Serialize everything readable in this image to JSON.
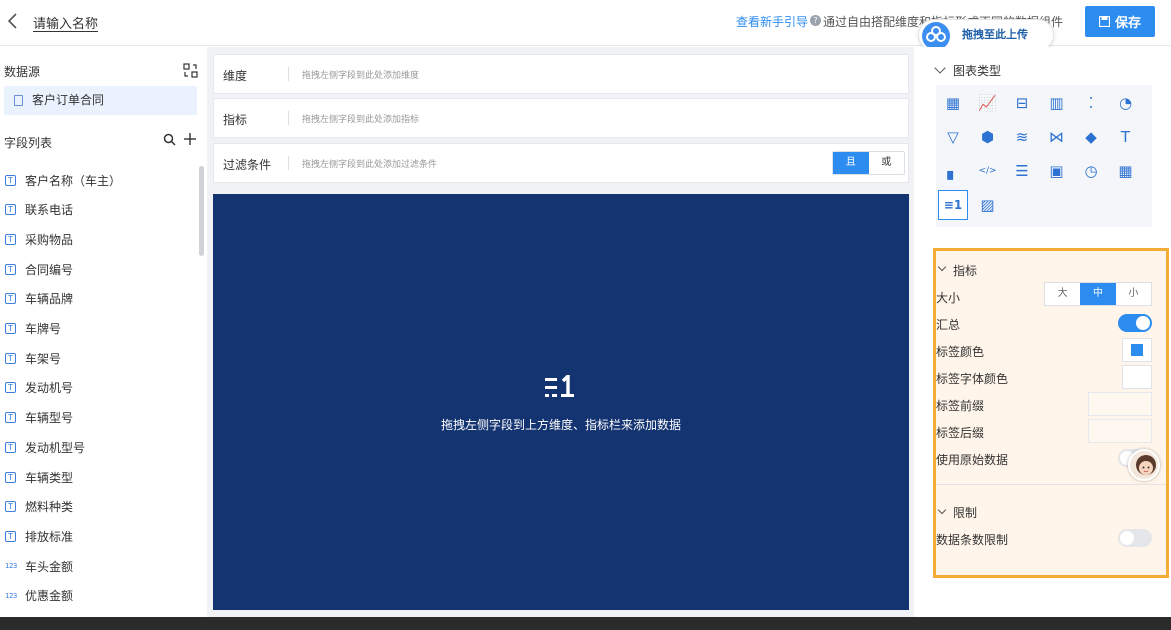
{
  "header": {
    "title": "请输入名称",
    "guide_link": "查看新手引导",
    "description": "通过自由搭配维度和指标形成不同的数据组件",
    "save_label": "保存",
    "upload_label": "拖拽至此上传"
  },
  "left": {
    "datasource_title": "数据源",
    "datasource_item": "客户订单合同",
    "field_list_title": "字段列表",
    "fields": [
      {
        "type": "T",
        "name": "客户名称（车主）"
      },
      {
        "type": "T",
        "name": "联系电话"
      },
      {
        "type": "T",
        "name": "采购物品"
      },
      {
        "type": "T",
        "name": "合同编号"
      },
      {
        "type": "T",
        "name": "车辆品牌"
      },
      {
        "type": "T",
        "name": "车牌号"
      },
      {
        "type": "T",
        "name": "车架号"
      },
      {
        "type": "T",
        "name": "发动机号"
      },
      {
        "type": "T",
        "name": "车辆型号"
      },
      {
        "type": "T",
        "name": "发动机型号"
      },
      {
        "type": "T",
        "name": "车辆类型"
      },
      {
        "type": "T",
        "name": "燃料种类"
      },
      {
        "type": "T",
        "name": "排放标准"
      },
      {
        "type": "123",
        "name": "车头金额"
      },
      {
        "type": "123",
        "name": "优惠金额"
      }
    ]
  },
  "middle": {
    "dimension_label": "维度",
    "dimension_placeholder": "拖拽左侧字段到此处添加维度",
    "metric_label": "指标",
    "metric_placeholder": "拖拽左侧字段到此处添加指标",
    "filter_label": "过滤条件",
    "filter_placeholder": "拖拽左侧字段到此处添加过滤条件",
    "filter_and": "且",
    "filter_or": "或",
    "canvas_message": "拖拽左侧字段到上方维度、指标栏来添加数据"
  },
  "right": {
    "chart_type_title": "图表类型",
    "chart_types": [
      "table",
      "line",
      "progress",
      "bar",
      "scatter",
      "pie",
      "funnel",
      "gauge-hex",
      "stripe",
      "sankey",
      "map",
      "text",
      "dot-bar",
      "code",
      "text-list",
      "dashboard",
      "speedometer",
      "grid",
      "metric",
      "image"
    ],
    "selected_chart_type": "metric",
    "metric_section_title": "指标",
    "size_label": "大小",
    "size_options": [
      "大",
      "中",
      "小"
    ],
    "size_selected": "中",
    "summary_label": "汇总",
    "summary_on": true,
    "label_color_label": "标签颜色",
    "label_color": "#2d8cf0",
    "label_font_color_label": "标签字体颜色",
    "label_prefix_label": "标签前缀",
    "label_suffix_label": "标签后缀",
    "use_raw_data_label": "使用原始数据",
    "use_raw_data_on": false,
    "limit_section_title": "限制",
    "row_limit_label": "数据条数限制",
    "row_limit_on": false
  },
  "colors": {
    "accent": "#2d8cf0",
    "canvas_bg": "#133371",
    "panel_highlight": "#f3ad37"
  }
}
